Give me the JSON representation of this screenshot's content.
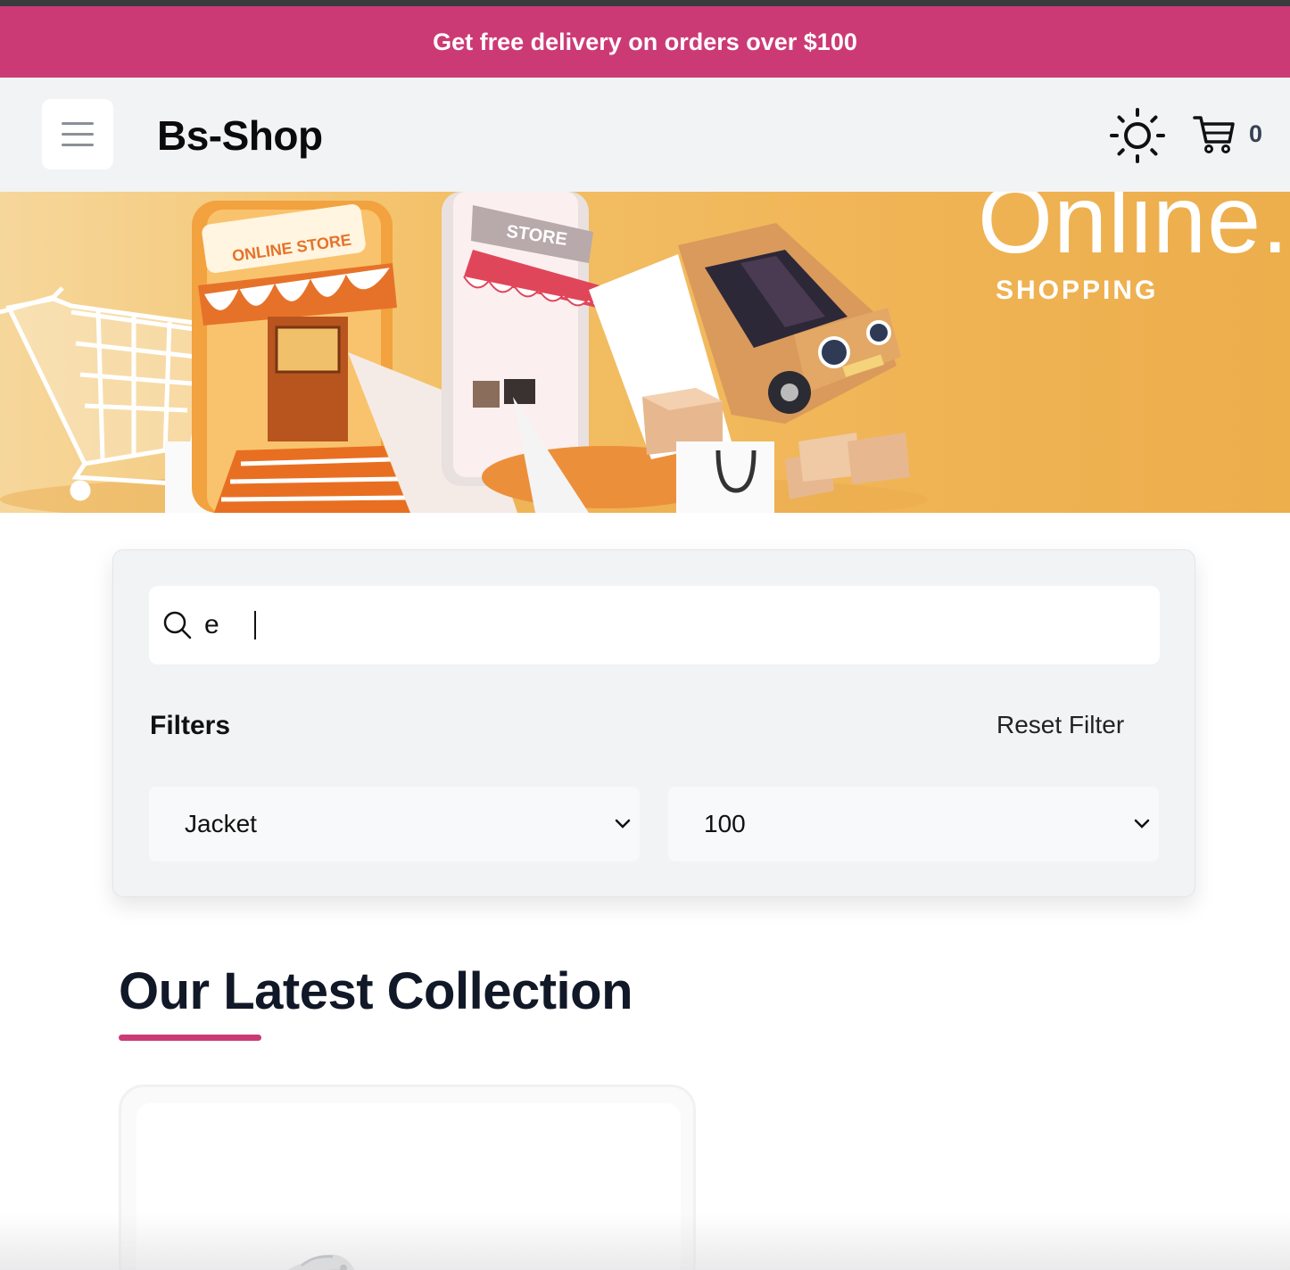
{
  "promo": {
    "text": "Get free delivery on orders over $100"
  },
  "header": {
    "logo": "Bs-Shop",
    "cart_count": "0"
  },
  "hero": {
    "title": "Online.",
    "subtitle": "SHOPPING",
    "store_sign": "ONLINE STORE",
    "phone_sign": "STORE"
  },
  "search": {
    "value": "e",
    "placeholder": ""
  },
  "filters": {
    "label": "Filters",
    "reset_label": "Reset Filter",
    "category_selected": "Jacket",
    "price_selected": "100"
  },
  "collection": {
    "title": "Our Latest Collection"
  },
  "colors": {
    "accent": "#cc3a76",
    "navbar_bg": "#f2f3f5",
    "hero_bg": "#f3c067"
  }
}
